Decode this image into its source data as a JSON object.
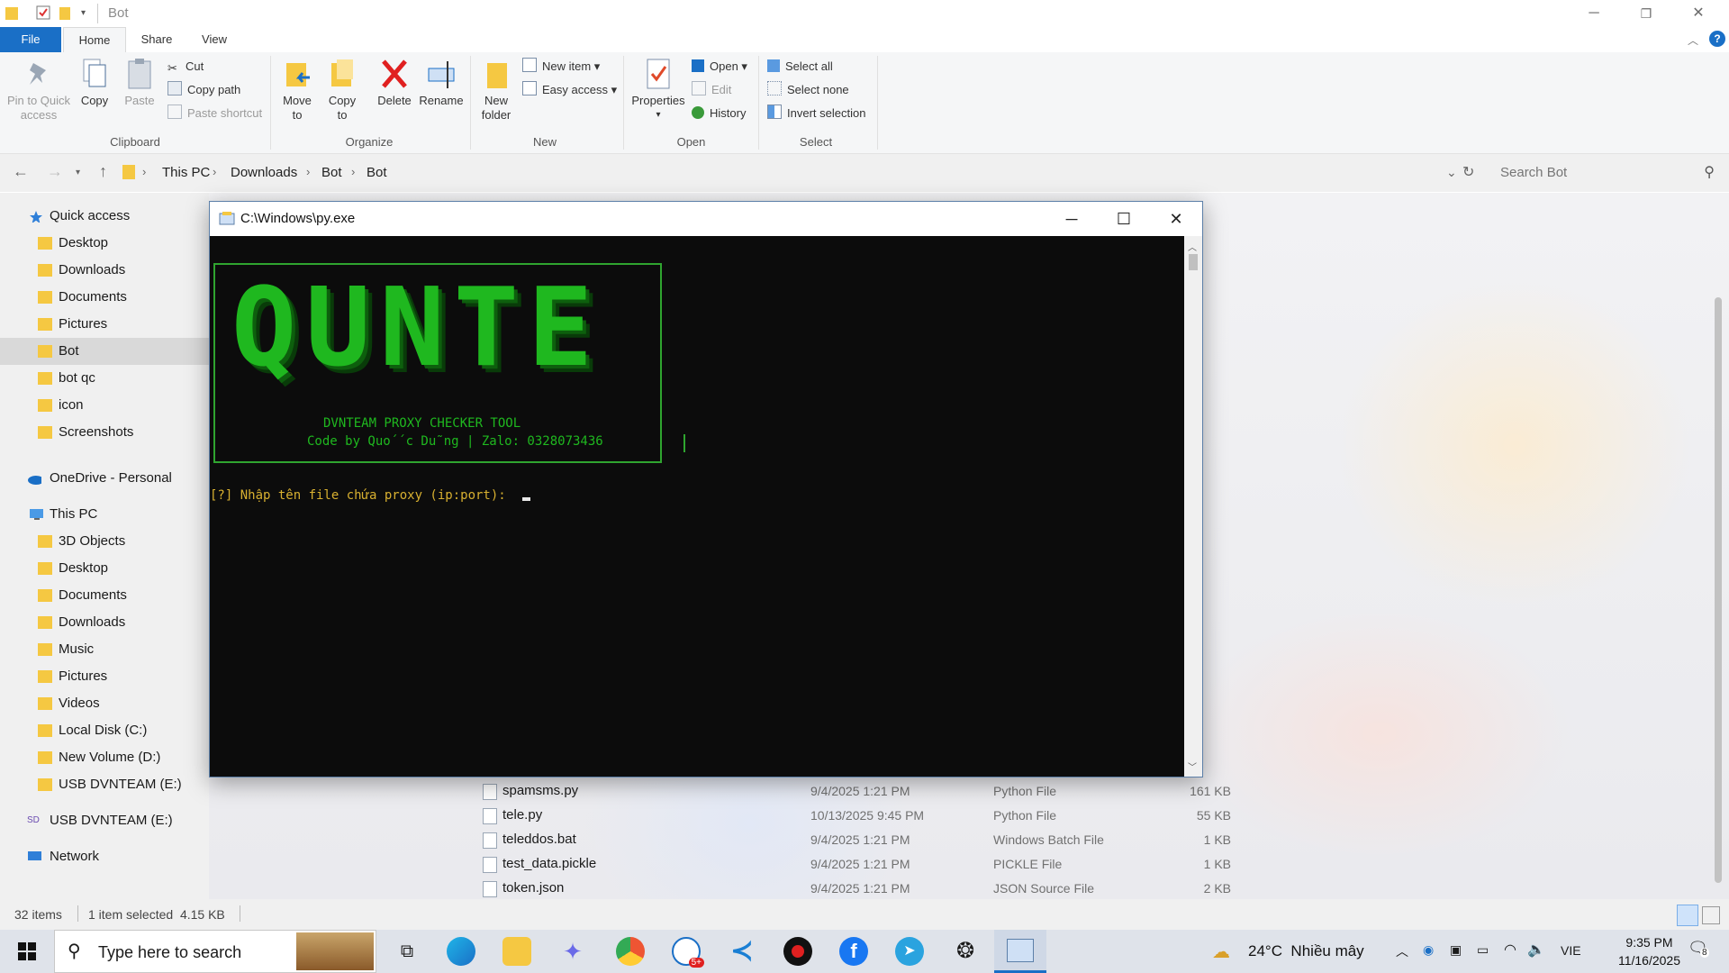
{
  "explorer": {
    "window_title": "Bot",
    "tabs": [
      "File",
      "Home",
      "Share",
      "View"
    ],
    "ribbon": {
      "clipboard": {
        "pin": "Pin to Quick\naccess",
        "copy": "Copy",
        "paste": "Paste",
        "cut": "Cut",
        "copy_path": "Copy path",
        "paste_shortcut": "Paste shortcut",
        "label": "Clipboard"
      },
      "organize": {
        "move_to": "Move\nto",
        "copy_to": "Copy\nto",
        "delete": "Delete",
        "rename": "Rename",
        "label": "Organize"
      },
      "new": {
        "new_folder": "New\nfolder",
        "new_item": "New item",
        "easy_access": "Easy access",
        "label": "New"
      },
      "open": {
        "properties": "Properties",
        "open": "Open",
        "edit": "Edit",
        "history": "History",
        "label": "Open"
      },
      "select": {
        "select_all": "Select all",
        "select_none": "Select none",
        "invert_selection": "Invert selection",
        "label": "Select"
      }
    },
    "breadcrumb": [
      "This PC",
      "Downloads",
      "Bot",
      "Bot"
    ],
    "search_placeholder": "Search Bot",
    "nav": {
      "quick_access": "Quick access",
      "quick_items": [
        "Desktop",
        "Downloads",
        "Documents",
        "Pictures",
        "Bot",
        "bot qc",
        "icon",
        "Screenshots"
      ],
      "onedrive": "OneDrive - Personal",
      "this_pc": "This PC",
      "pc_items": [
        "3D Objects",
        "Desktop",
        "Documents",
        "Downloads",
        "Music",
        "Pictures",
        "Videos",
        "Local Disk (C:)",
        "New Volume (D:)",
        "USB DVNTEAM (E:)"
      ],
      "usb": "USB DVNTEAM (E:)",
      "network": "Network"
    },
    "files": [
      {
        "name": "spamsms.py",
        "date": "9/4/2025 1:21 PM",
        "type": "Python File",
        "size": "161 KB"
      },
      {
        "name": "tele.py",
        "date": "10/13/2025 9:45 PM",
        "type": "Python File",
        "size": "55 KB"
      },
      {
        "name": "teleddos.bat",
        "date": "9/4/2025 1:21 PM",
        "type": "Windows Batch File",
        "size": "1 KB"
      },
      {
        "name": "test_data.pickle",
        "date": "9/4/2025 1:21 PM",
        "type": "PICKLE File",
        "size": "1 KB"
      },
      {
        "name": "token.json",
        "date": "9/4/2025 1:21 PM",
        "type": "JSON Source File",
        "size": "2 KB"
      }
    ],
    "status": {
      "items": "32 items",
      "selected": "1 item selected  4.15 KB"
    }
  },
  "console": {
    "title": "C:\\Windows\\py.exe",
    "logo": "QUNTE",
    "tool_name": "DVNTEAM PROXY CHECKER TOOL",
    "credit": "Code by Quo´´c Du˜ng | Zalo: 0328073436",
    "prompt": "[?] Nhập tên file chứa proxy (ip:port): "
  },
  "taskbar": {
    "search_placeholder": "Type here to search",
    "weather": "24°C  Nhiều mây",
    "language": "VIE",
    "time": "9:35 PM",
    "date": "11/16/2025",
    "notification_count": "8",
    "zalo_badge": "5+"
  },
  "colors": {
    "console_green": "#1fb81f",
    "console_prompt": "#d8b030",
    "file_tab": "#1a6fc6"
  }
}
